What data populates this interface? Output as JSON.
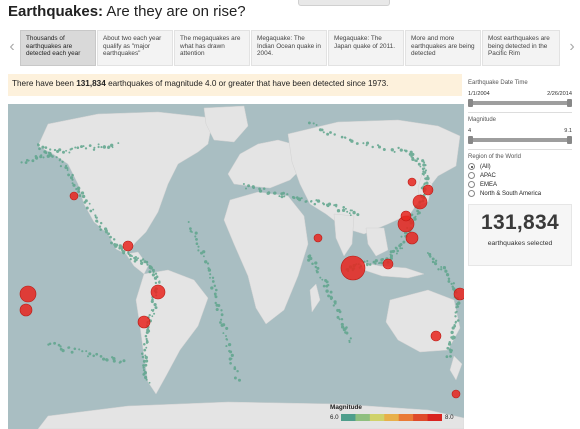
{
  "page": {
    "title_bold": "Earthquakes:",
    "title_rest": " Are they are on rise?"
  },
  "story_points": [
    {
      "label": "Thousands of earthquakes are detected each year",
      "active": true
    },
    {
      "label": "About two each year qualify as \"major earthquakes\"",
      "active": false
    },
    {
      "label": "The megaquakes are what has drawn attention",
      "active": false
    },
    {
      "label": "Megaquake: The Indian Ocean quake in 2004.",
      "active": false
    },
    {
      "label": "Megaquake: The Japan quake of 2011.",
      "active": false
    },
    {
      "label": "More and more earthquakes are being detected",
      "active": false
    },
    {
      "label": "Most earthquakes are being detected in the Pacific Rim",
      "active": false
    }
  ],
  "nav": {
    "prev_icon": "chevron-left-icon",
    "next_icon": "chevron-right-icon"
  },
  "caption": {
    "prefix": "There have been ",
    "count": "131,834",
    "suffix": " earthquakes of magnitude 4.0 or greater that have been detected since 1973."
  },
  "filters": {
    "date": {
      "label": "Earthquake Date Time",
      "min": "1/1/2004",
      "max": "2/26/2014"
    },
    "magnitude": {
      "label": "Magnitude",
      "min": "4",
      "max": "9.1"
    },
    "region": {
      "label": "Region of the World",
      "options": [
        {
          "label": "(All)",
          "selected": true
        },
        {
          "label": "APAC",
          "selected": false
        },
        {
          "label": "EMEA",
          "selected": false
        },
        {
          "label": "North & South America",
          "selected": false
        }
      ]
    }
  },
  "summary": {
    "count": "131,834",
    "label": "earthquakes selected"
  },
  "legend": {
    "title": "Magnitude",
    "min": "6.0",
    "max": "8.0",
    "colors": [
      "#4f9e8c",
      "#8fbf7f",
      "#cfd26a",
      "#e8b04a",
      "#e97a36",
      "#df4a2a",
      "#d8231f"
    ]
  },
  "map": {
    "ocean_color": "#a9bec2",
    "land_color": "#e4e4e4",
    "small_quake_color": "#5fa58c",
    "large_quake_color": "#e8261e"
  }
}
